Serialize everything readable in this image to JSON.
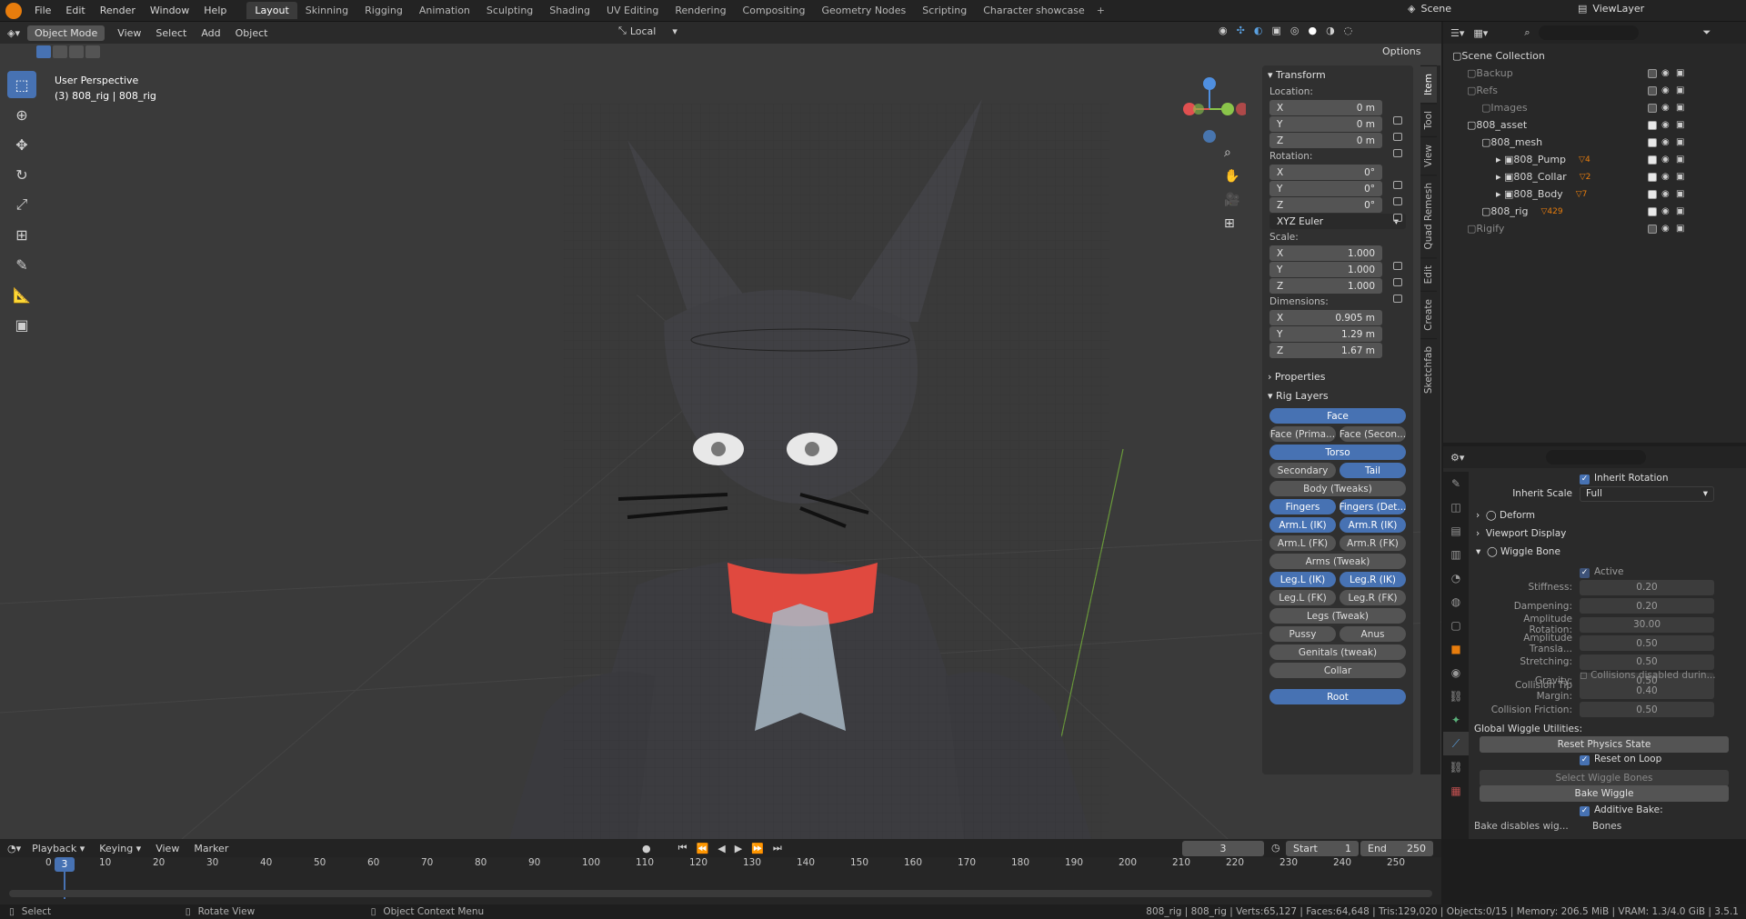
{
  "menu": [
    "File",
    "Edit",
    "Render",
    "Window",
    "Help"
  ],
  "workspaces": [
    "Layout",
    "Skinning",
    "Rigging",
    "Animation",
    "Sculpting",
    "Shading",
    "UV Editing",
    "Rendering",
    "Compositing",
    "Geometry Nodes",
    "Scripting",
    "Character showcase"
  ],
  "active_workspace": "Layout",
  "scene": "Scene",
  "view_layer": "ViewLayer",
  "viewport": {
    "mode": "Object Mode",
    "menus": [
      "View",
      "Select",
      "Add",
      "Object"
    ],
    "orientation": "Local",
    "options": "Options",
    "title": "User Perspective",
    "subtitle": "(3) 808_rig | 808_rig"
  },
  "tabs": [
    "Item",
    "Tool",
    "View",
    "Quad Remesh",
    "Edit",
    "Create",
    "Sketchfab"
  ],
  "transform": {
    "header": "Transform",
    "location_label": "Location:",
    "location": [
      [
        "X",
        "0 m"
      ],
      [
        "Y",
        "0 m"
      ],
      [
        "Z",
        "0 m"
      ]
    ],
    "rotation_label": "Rotation:",
    "rotation": [
      [
        "X",
        "0°"
      ],
      [
        "Y",
        "0°"
      ],
      [
        "Z",
        "0°"
      ]
    ],
    "rotation_mode": "XYZ Euler",
    "scale_label": "Scale:",
    "scale": [
      [
        "X",
        "1.000"
      ],
      [
        "Y",
        "1.000"
      ],
      [
        "Z",
        "1.000"
      ]
    ],
    "dimensions_label": "Dimensions:",
    "dimensions": [
      [
        "X",
        "0.905 m"
      ],
      [
        "Y",
        "1.29 m"
      ],
      [
        "Z",
        "1.67 m"
      ]
    ]
  },
  "properties_header": "Properties",
  "rig_layers": {
    "header": "Rig Layers",
    "rows": [
      [
        {
          "l": "Face",
          "on": true
        }
      ],
      [
        {
          "l": "Face (Prima...",
          "on": false
        },
        {
          "l": "Face (Secon...",
          "on": false
        }
      ],
      [
        {
          "l": "Torso",
          "on": true
        }
      ],
      [
        {
          "l": "Secondary",
          "on": false
        },
        {
          "l": "Tail",
          "on": true
        }
      ],
      [
        {
          "l": "Body (Tweaks)",
          "on": false
        }
      ],
      [
        {
          "l": "Fingers",
          "on": true
        },
        {
          "l": "Fingers (Det...",
          "on": true
        }
      ],
      [
        {
          "l": "Arm.L (IK)",
          "on": true
        },
        {
          "l": "Arm.R (IK)",
          "on": true
        }
      ],
      [
        {
          "l": "Arm.L (FK)",
          "on": false
        },
        {
          "l": "Arm.R (FK)",
          "on": false
        }
      ],
      [
        {
          "l": "Arms (Tweak)",
          "on": false
        }
      ],
      [
        {
          "l": "Leg.L (IK)",
          "on": true
        },
        {
          "l": "Leg.R (IK)",
          "on": true
        }
      ],
      [
        {
          "l": "Leg.L (FK)",
          "on": false
        },
        {
          "l": "Leg.R (FK)",
          "on": false
        }
      ],
      [
        {
          "l": "Legs (Tweak)",
          "on": false
        }
      ],
      [
        {
          "l": "Pussy",
          "on": false
        },
        {
          "l": "Anus",
          "on": false
        }
      ],
      [
        {
          "l": "Genitals (tweak)",
          "on": false
        }
      ],
      [
        {
          "l": "Collar",
          "on": false
        }
      ]
    ],
    "root": "Root"
  },
  "outliner": {
    "rows": [
      {
        "t": "Scene Collection",
        "d": 0,
        "dim": false,
        "chk": false
      },
      {
        "t": "Backup",
        "d": 1,
        "dim": true,
        "chk": true,
        "on": false
      },
      {
        "t": "Refs",
        "d": 1,
        "dim": true,
        "chk": true,
        "on": false
      },
      {
        "t": "Images",
        "d": 2,
        "dim": true,
        "chk": true,
        "on": false
      },
      {
        "t": "808_asset",
        "d": 1,
        "dim": false,
        "chk": true,
        "on": true
      },
      {
        "t": "808_mesh",
        "d": 2,
        "dim": false,
        "chk": true,
        "on": true
      },
      {
        "t": "808_Pump",
        "d": 3,
        "dim": false,
        "chk": true,
        "on": true,
        "badge": "4"
      },
      {
        "t": "808_Collar",
        "d": 3,
        "dim": false,
        "chk": true,
        "on": true,
        "badge": "2"
      },
      {
        "t": "808_Body",
        "d": 3,
        "dim": false,
        "chk": true,
        "on": true,
        "badge": "7"
      },
      {
        "t": "808_rig",
        "d": 2,
        "dim": false,
        "chk": true,
        "on": true,
        "badge": "429"
      },
      {
        "t": "Rigify",
        "d": 1,
        "dim": true,
        "chk": true,
        "on": false
      }
    ]
  },
  "bone_props": {
    "inherit_rotation": "Inherit Rotation",
    "inherit_scale_label": "Inherit Scale",
    "inherit_scale": "Full",
    "deform": "Deform",
    "viewport_display": "Viewport Display",
    "wiggle_bone": "Wiggle Bone",
    "active": "Active",
    "params": [
      [
        "Stiffness:",
        "0.20"
      ],
      [
        "Dampening:",
        "0.20"
      ],
      [
        "Amplitude Rotation:",
        "30.00"
      ],
      [
        "Amplitude Transla...",
        "0.50"
      ],
      [
        "Stretching:",
        "0.50"
      ],
      [
        "Gravity:",
        "0.50"
      ]
    ],
    "collisions": "Collisions disabled durin...",
    "params2": [
      [
        "Collision Tip Margin:",
        "0.40"
      ],
      [
        "Collision Friction:",
        "0.50"
      ]
    ],
    "global_label": "Global Wiggle Utilities:",
    "reset_physics": "Reset Physics State",
    "reset_on_loop": "Reset on Loop",
    "select_wiggle": "Select Wiggle Bones",
    "bake_wiggle": "Bake Wiggle",
    "additive_bake": "Additive Bake:",
    "bake_disables": "Bake disables wig...",
    "bones": "Bones"
  },
  "timeline": {
    "menus": [
      "Playback",
      "Keying",
      "View",
      "Marker"
    ],
    "current": "3",
    "start_label": "Start",
    "start": "1",
    "end_label": "End",
    "end": "250",
    "ticks": [
      "0",
      "10",
      "20",
      "30",
      "40",
      "50",
      "60",
      "70",
      "80",
      "90",
      "100",
      "110",
      "120",
      "130",
      "140",
      "150",
      "160",
      "170",
      "180",
      "190",
      "200",
      "210",
      "220",
      "230",
      "240",
      "250"
    ],
    "frame_marker": "3"
  },
  "status": {
    "select": "Select",
    "rotate": "Rotate View",
    "context": "Object Context Menu",
    "info": "808_rig | 808_rig | Verts:65,127 | Faces:64,648 | Tris:129,020 | Objects:0/15 | Memory: 206.5 MiB | VRAM: 1.3/4.0 GiB | 3.5.1"
  },
  "colors": {
    "accent": "#4772b3",
    "collar": "#e0493f",
    "axis_x": "#e05050",
    "axis_y": "#8ac44a",
    "axis_z": "#4f8fe0"
  }
}
